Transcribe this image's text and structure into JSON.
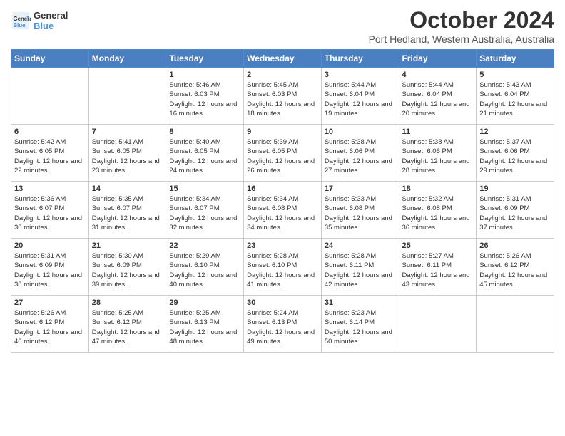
{
  "logo": {
    "line1": "General",
    "line2": "Blue"
  },
  "title": "October 2024",
  "subtitle": "Port Hedland, Western Australia, Australia",
  "days_header": [
    "Sunday",
    "Monday",
    "Tuesday",
    "Wednesday",
    "Thursday",
    "Friday",
    "Saturday"
  ],
  "weeks": [
    [
      {
        "day": "",
        "info": ""
      },
      {
        "day": "",
        "info": ""
      },
      {
        "day": "1",
        "info": "Sunrise: 5:46 AM\nSunset: 6:03 PM\nDaylight: 12 hours and 16 minutes."
      },
      {
        "day": "2",
        "info": "Sunrise: 5:45 AM\nSunset: 6:03 PM\nDaylight: 12 hours and 18 minutes."
      },
      {
        "day": "3",
        "info": "Sunrise: 5:44 AM\nSunset: 6:04 PM\nDaylight: 12 hours and 19 minutes."
      },
      {
        "day": "4",
        "info": "Sunrise: 5:44 AM\nSunset: 6:04 PM\nDaylight: 12 hours and 20 minutes."
      },
      {
        "day": "5",
        "info": "Sunrise: 5:43 AM\nSunset: 6:04 PM\nDaylight: 12 hours and 21 minutes."
      }
    ],
    [
      {
        "day": "6",
        "info": "Sunrise: 5:42 AM\nSunset: 6:05 PM\nDaylight: 12 hours and 22 minutes."
      },
      {
        "day": "7",
        "info": "Sunrise: 5:41 AM\nSunset: 6:05 PM\nDaylight: 12 hours and 23 minutes."
      },
      {
        "day": "8",
        "info": "Sunrise: 5:40 AM\nSunset: 6:05 PM\nDaylight: 12 hours and 24 minutes."
      },
      {
        "day": "9",
        "info": "Sunrise: 5:39 AM\nSunset: 6:05 PM\nDaylight: 12 hours and 26 minutes."
      },
      {
        "day": "10",
        "info": "Sunrise: 5:38 AM\nSunset: 6:06 PM\nDaylight: 12 hours and 27 minutes."
      },
      {
        "day": "11",
        "info": "Sunrise: 5:38 AM\nSunset: 6:06 PM\nDaylight: 12 hours and 28 minutes."
      },
      {
        "day": "12",
        "info": "Sunrise: 5:37 AM\nSunset: 6:06 PM\nDaylight: 12 hours and 29 minutes."
      }
    ],
    [
      {
        "day": "13",
        "info": "Sunrise: 5:36 AM\nSunset: 6:07 PM\nDaylight: 12 hours and 30 minutes."
      },
      {
        "day": "14",
        "info": "Sunrise: 5:35 AM\nSunset: 6:07 PM\nDaylight: 12 hours and 31 minutes."
      },
      {
        "day": "15",
        "info": "Sunrise: 5:34 AM\nSunset: 6:07 PM\nDaylight: 12 hours and 32 minutes."
      },
      {
        "day": "16",
        "info": "Sunrise: 5:34 AM\nSunset: 6:08 PM\nDaylight: 12 hours and 34 minutes."
      },
      {
        "day": "17",
        "info": "Sunrise: 5:33 AM\nSunset: 6:08 PM\nDaylight: 12 hours and 35 minutes."
      },
      {
        "day": "18",
        "info": "Sunrise: 5:32 AM\nSunset: 6:08 PM\nDaylight: 12 hours and 36 minutes."
      },
      {
        "day": "19",
        "info": "Sunrise: 5:31 AM\nSunset: 6:09 PM\nDaylight: 12 hours and 37 minutes."
      }
    ],
    [
      {
        "day": "20",
        "info": "Sunrise: 5:31 AM\nSunset: 6:09 PM\nDaylight: 12 hours and 38 minutes."
      },
      {
        "day": "21",
        "info": "Sunrise: 5:30 AM\nSunset: 6:09 PM\nDaylight: 12 hours and 39 minutes."
      },
      {
        "day": "22",
        "info": "Sunrise: 5:29 AM\nSunset: 6:10 PM\nDaylight: 12 hours and 40 minutes."
      },
      {
        "day": "23",
        "info": "Sunrise: 5:28 AM\nSunset: 6:10 PM\nDaylight: 12 hours and 41 minutes."
      },
      {
        "day": "24",
        "info": "Sunrise: 5:28 AM\nSunset: 6:11 PM\nDaylight: 12 hours and 42 minutes."
      },
      {
        "day": "25",
        "info": "Sunrise: 5:27 AM\nSunset: 6:11 PM\nDaylight: 12 hours and 43 minutes."
      },
      {
        "day": "26",
        "info": "Sunrise: 5:26 AM\nSunset: 6:12 PM\nDaylight: 12 hours and 45 minutes."
      }
    ],
    [
      {
        "day": "27",
        "info": "Sunrise: 5:26 AM\nSunset: 6:12 PM\nDaylight: 12 hours and 46 minutes."
      },
      {
        "day": "28",
        "info": "Sunrise: 5:25 AM\nSunset: 6:12 PM\nDaylight: 12 hours and 47 minutes."
      },
      {
        "day": "29",
        "info": "Sunrise: 5:25 AM\nSunset: 6:13 PM\nDaylight: 12 hours and 48 minutes."
      },
      {
        "day": "30",
        "info": "Sunrise: 5:24 AM\nSunset: 6:13 PM\nDaylight: 12 hours and 49 minutes."
      },
      {
        "day": "31",
        "info": "Sunrise: 5:23 AM\nSunset: 6:14 PM\nDaylight: 12 hours and 50 minutes."
      },
      {
        "day": "",
        "info": ""
      },
      {
        "day": "",
        "info": ""
      }
    ]
  ]
}
